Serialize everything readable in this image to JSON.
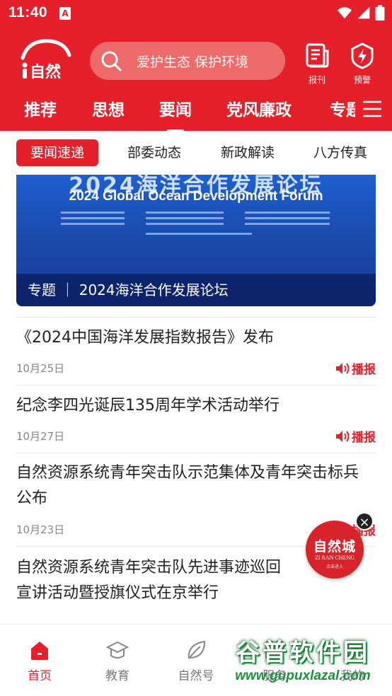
{
  "status_bar": {
    "time": "11:40",
    "sim_label": "A"
  },
  "header": {
    "logo_text": "i自然",
    "search_placeholder": "爱护生态 保护环境",
    "newspaper_label": "报刊",
    "alert_label": "预警"
  },
  "tabs": [
    {
      "label": "推荐"
    },
    {
      "label": "思想"
    },
    {
      "label": "要闻",
      "active": true
    },
    {
      "label": "党风廉政"
    },
    {
      "label": "专题"
    }
  ],
  "subtabs": [
    {
      "label": "要闻速递",
      "active": true
    },
    {
      "label": "部委动态"
    },
    {
      "label": "新政解读"
    },
    {
      "label": "八方传真"
    }
  ],
  "banner": {
    "headline_cn": "2024海洋合作发展论坛",
    "headline_en": "2024 Global Ocean Development Forum",
    "caption": "专题 ｜ 2024海洋合作发展论坛"
  },
  "news": [
    {
      "title": "《2024中国海洋发展指数报告》发布",
      "date": "10月25日",
      "broadcast": "播报"
    },
    {
      "title": "纪念李四光诞辰135周年学术活动举行",
      "date": "10月27日",
      "broadcast": "播报"
    },
    {
      "title": "自然资源系统青年突击队示范集体及青年突击标兵公布",
      "date": "10月23日",
      "broadcast": "播报"
    },
    {
      "title": "自然资源系统青年突击队先进事迹巡回宣讲活动暨授旗仪式在京举行"
    }
  ],
  "floating_badge": {
    "title": "自然城",
    "subtitle": "ZI RAN CHENG",
    "tagline": "点击进入"
  },
  "bottom_nav": [
    {
      "label": "首页",
      "icon": "home-icon",
      "active": true
    },
    {
      "label": "教育",
      "icon": "graduation-cap-icon"
    },
    {
      "label": "自然号",
      "icon": "leaf-icon"
    },
    {
      "label": "服务",
      "icon": "grid-icon"
    },
    {
      "label": "我的",
      "icon": "user-icon"
    }
  ],
  "watermark": {
    "title": "谷普软件园",
    "url": "www.gupuxlazal.com"
  },
  "colors": {
    "brand_red": "#e5202b",
    "text": "#222222",
    "muted": "#888888"
  }
}
